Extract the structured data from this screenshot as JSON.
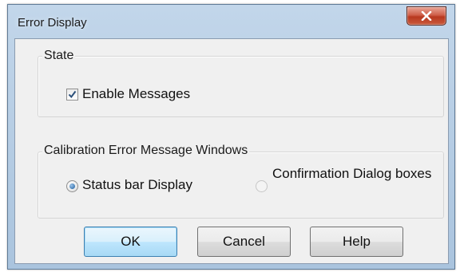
{
  "window": {
    "title": "Error Display"
  },
  "title_buttons": {
    "close_icon": "close-icon"
  },
  "state_group": {
    "title": "State",
    "enable_messages": {
      "label": "Enable Messages",
      "checked": true
    }
  },
  "calibration_group": {
    "title": "Calibration Error Message Windows",
    "options": [
      {
        "label": "Status bar Display",
        "selected": true
      },
      {
        "label": "Confirmation Dialog boxes",
        "selected": false
      }
    ]
  },
  "buttons": {
    "ok": "OK",
    "cancel": "Cancel",
    "help": "Help"
  },
  "colors": {
    "titlebar": "#b4cce4",
    "close_button": "#c9452a",
    "dialog_face": "#f0f0f0",
    "default_button_border": "#3c7fb1",
    "radio_selected": "#1a5c9e"
  }
}
